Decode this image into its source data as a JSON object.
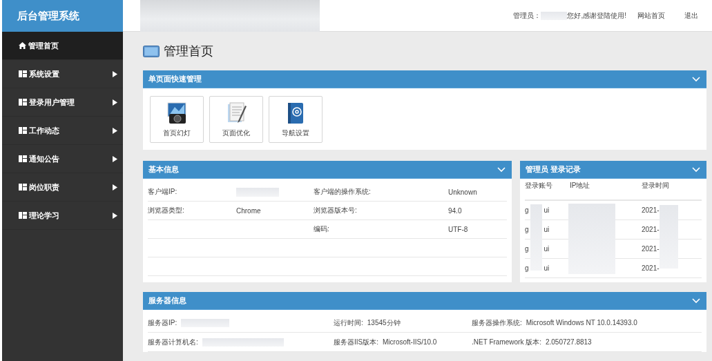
{
  "brand": "后台管理系统",
  "top_bar": {
    "admin_label": "管理员：",
    "greeting": "您好,感谢登陆使用!",
    "links": [
      "网站首页",
      "退出"
    ]
  },
  "sidebar": {
    "items": [
      {
        "label": "管理首页",
        "kind": "home",
        "selected": true,
        "has_submenu": false
      },
      {
        "label": "系统设置",
        "kind": "section",
        "selected": false,
        "has_submenu": true
      },
      {
        "label": "登录用户管理",
        "kind": "section",
        "selected": false,
        "has_submenu": true
      },
      {
        "label": "工作动态",
        "kind": "section",
        "selected": false,
        "has_submenu": true
      },
      {
        "label": "通知公告",
        "kind": "section",
        "selected": false,
        "has_submenu": true
      },
      {
        "label": "岗位职责",
        "kind": "section",
        "selected": false,
        "has_submenu": true
      },
      {
        "label": "理论学习",
        "kind": "section",
        "selected": false,
        "has_submenu": true
      }
    ]
  },
  "page_title": "管理首页",
  "quick_panel": {
    "title": "单页面快速管理",
    "shortcuts": [
      {
        "label": "首页幻灯",
        "kind": "camera"
      },
      {
        "label": "页面优化",
        "kind": "document"
      },
      {
        "label": "导航设置",
        "kind": "book"
      }
    ]
  },
  "basic_info": {
    "title": "基本信息",
    "rows": [
      [
        {
          "label": "客户端IP:"
        },
        {
          "label": "客户端的操作系统:",
          "value": "Unknown"
        }
      ],
      [
        {
          "label": "浏览器类型:",
          "value": "Chrome"
        },
        {
          "label": "浏览器版本号:",
          "value": "94.0"
        }
      ],
      [
        null,
        {
          "label": "编码:",
          "value": "UTF-8"
        }
      ],
      [
        null,
        null
      ],
      [
        null,
        null
      ]
    ]
  },
  "login_records": {
    "title": "管理员 登录记录",
    "columns": [
      "登录账号",
      "IP地址",
      "登录时间"
    ],
    "rows": [
      {
        "account_start": "g",
        "account_end": "ui",
        "time": "2021-"
      },
      {
        "account_start": "g",
        "account_end": "ui",
        "time": "2021-"
      },
      {
        "account_start": "g",
        "account_end": "ui",
        "time": "2021-"
      },
      {
        "account_start": "g",
        "account_end": "ui",
        "time": "2021-"
      }
    ]
  },
  "server_info": {
    "title": "服务器信息",
    "rows": [
      [
        {
          "label": "服务器IP:"
        },
        {
          "label": "运行时间:",
          "value": "13545分钟"
        },
        {
          "label": "服务器操作系统:",
          "value": "Microsoft Windows NT 10.0.14393.0"
        }
      ],
      [
        {
          "label": "服务器计算机名:"
        },
        {
          "label": "服务器IIS版本:",
          "value": "Microsoft-IIS/10.0"
        },
        {
          "label": ".NET Framework 版本:",
          "value": "2.050727.8813"
        }
      ]
    ]
  }
}
